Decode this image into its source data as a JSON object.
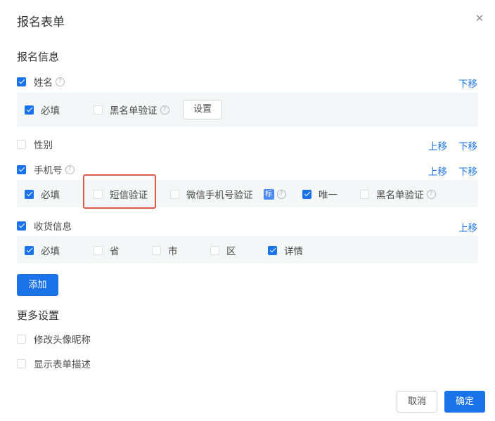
{
  "dialog": {
    "title": "报名表单",
    "close_icon": "close-icon"
  },
  "section_info": {
    "title": "报名信息"
  },
  "fields": {
    "name": {
      "label": "姓名",
      "move_down": "下移",
      "required": "必填",
      "blacklist": "黑名单验证",
      "settings_button": "设置"
    },
    "gender": {
      "label": "性别",
      "move_up": "上移",
      "move_down": "下移"
    },
    "phone": {
      "label": "手机号",
      "move_up": "上移",
      "move_down": "下移",
      "required": "必填",
      "sms_verify": "短信验证",
      "wechat_verify": "微信手机号验证",
      "badge": "标",
      "unique": "唯一",
      "blacklist": "黑名单验证"
    },
    "shipping": {
      "label": "收货信息",
      "move_up": "上移",
      "required": "必填",
      "province": "省",
      "city": "市",
      "district": "区",
      "detail": "详情"
    }
  },
  "add_button": "添加",
  "more_settings": {
    "title": "更多设置",
    "edit_avatar": "修改头像昵称",
    "show_desc": "显示表单描述"
  },
  "footer": {
    "cancel": "取消",
    "confirm": "确定"
  },
  "colors": {
    "accent": "#1a73e8",
    "panel_bg": "#f5f6f8",
    "highlight": "#e0584a"
  }
}
